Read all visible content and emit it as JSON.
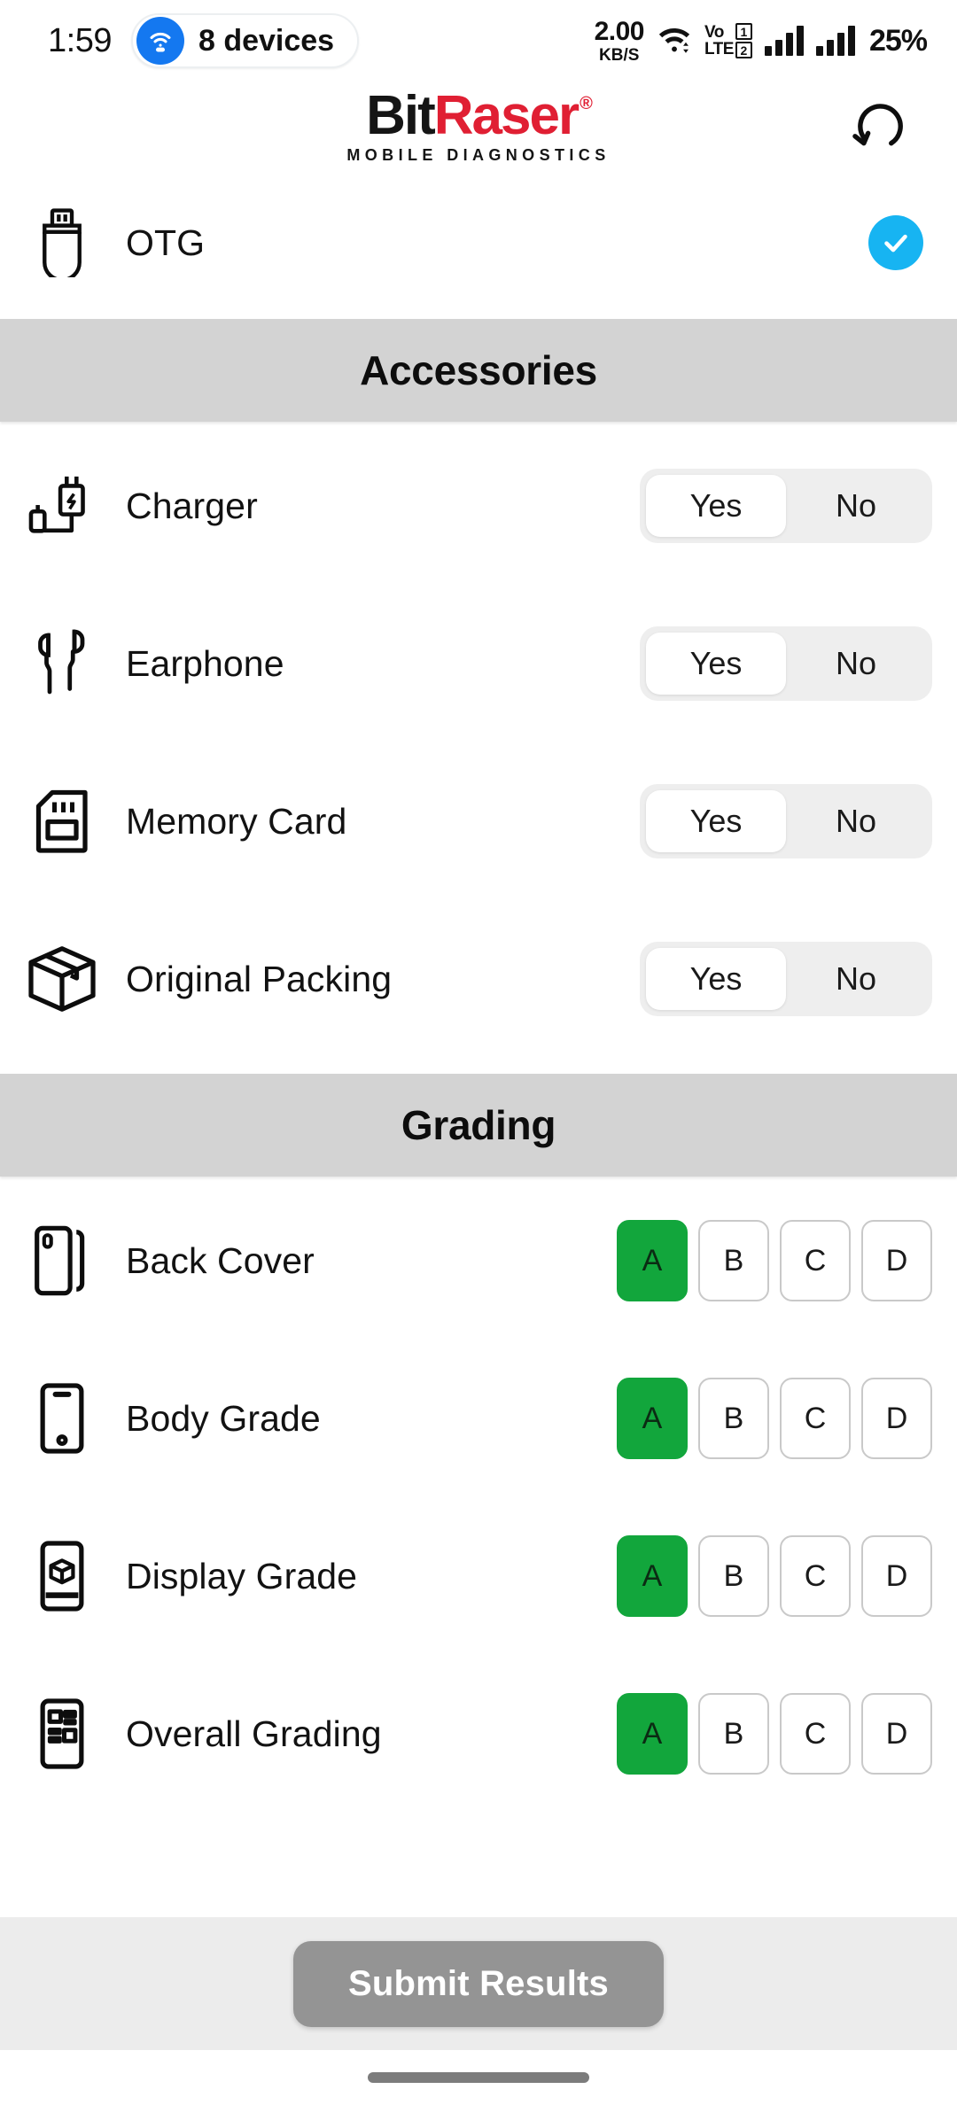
{
  "status_bar": {
    "clock": "1:59",
    "hotspot_chip_label": "8 devices",
    "hotspot_icon": "wifi-tethering-icon",
    "net_speed_value": "2.00",
    "net_speed_unit": "KB/S",
    "wifi_icon": "wifi-icon",
    "volte_line1": "Vo",
    "volte_line2": "LTE",
    "sim1": "1",
    "sim2": "2",
    "battery": "25%"
  },
  "header": {
    "logo_bit": "Bit",
    "logo_raser": "Raser",
    "logo_registered": "®",
    "tagline": "MOBILE DIAGNOSTICS",
    "refresh_icon": "refresh-icon"
  },
  "otg": {
    "icon": "usb-drive-icon",
    "label": "OTG",
    "status_icon": "check-circle-icon",
    "status_color": "#17b4f2"
  },
  "accessories": {
    "section_title": "Accessories",
    "options": [
      "Yes",
      "No"
    ],
    "items": [
      {
        "icon": "charger-icon",
        "label": "Charger",
        "selected": "Yes"
      },
      {
        "icon": "earphone-icon",
        "label": "Earphone",
        "selected": "Yes"
      },
      {
        "icon": "memory-card-icon",
        "label": "Memory Card",
        "selected": "Yes"
      },
      {
        "icon": "package-box-icon",
        "label": "Original Packing",
        "selected": "Yes"
      }
    ]
  },
  "grading": {
    "section_title": "Grading",
    "options": [
      "A",
      "B",
      "C",
      "D"
    ],
    "selected_color": "#12a63c",
    "items": [
      {
        "icon": "phone-back-cover-icon",
        "label": "Back Cover",
        "selected": "A"
      },
      {
        "icon": "phone-body-icon",
        "label": "Body Grade",
        "selected": "A"
      },
      {
        "icon": "phone-display-icon",
        "label": "Display Grade",
        "selected": "A"
      },
      {
        "icon": "phone-overall-icon",
        "label": "Overall Grading",
        "selected": "A"
      }
    ]
  },
  "footer": {
    "submit_label": "Submit Results",
    "submit_color": "#949494"
  }
}
